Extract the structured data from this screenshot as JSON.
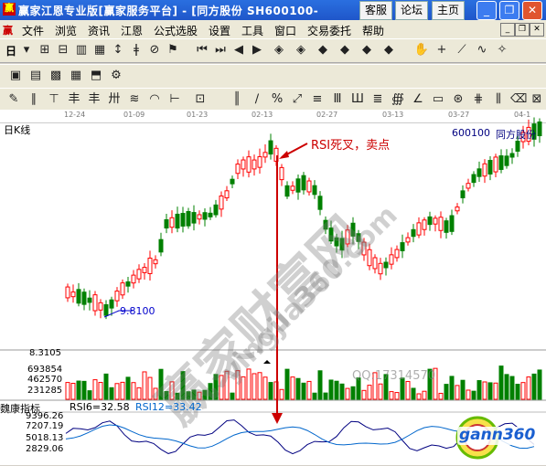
{
  "window": {
    "title": "赢家江恩专业版[赢家服务平台] - [同方股份 SH600100-",
    "title_buttons": [
      "客服",
      "论坛",
      "主页"
    ],
    "title_icon": "赢"
  },
  "menu": {
    "logo": "赢",
    "items": [
      "文件",
      "浏览",
      "资讯",
      "江恩",
      "公式选股",
      "设置",
      "工具",
      "窗口",
      "交易委托",
      "帮助"
    ]
  },
  "toolbar1": {
    "period_label": "日"
  },
  "chart": {
    "period_title": "日K线",
    "stock_code": "600100",
    "stock_name": "同方股份",
    "low_price_label": "9.8100",
    "dates": [
      "12-24",
      "01-09",
      "01-23",
      "02-13",
      "02-27",
      "03-13",
      "03-27",
      "04-1"
    ],
    "annotation": "RSI死叉，卖点",
    "volume_ticks": [
      "8.3105",
      "693854",
      "462570",
      "231285"
    ],
    "qq_watermark": "QQ:17314570",
    "indicator_name": "魏康指标",
    "rsi6_label": "RSI6=32.58",
    "rsi12_label": "RSI12=33.42",
    "indicator_ticks": [
      "9396.26",
      "7207.19",
      "5018.13",
      "2829.06"
    ],
    "watermark_main": "赢家财富网",
    "watermark_url": "yingjia360.com",
    "badge_text": "gann360",
    "colors": {
      "up": "#ff0000",
      "down": "#008000",
      "ma_low": "#0000cc",
      "annotation": "#cc0000"
    }
  }
}
